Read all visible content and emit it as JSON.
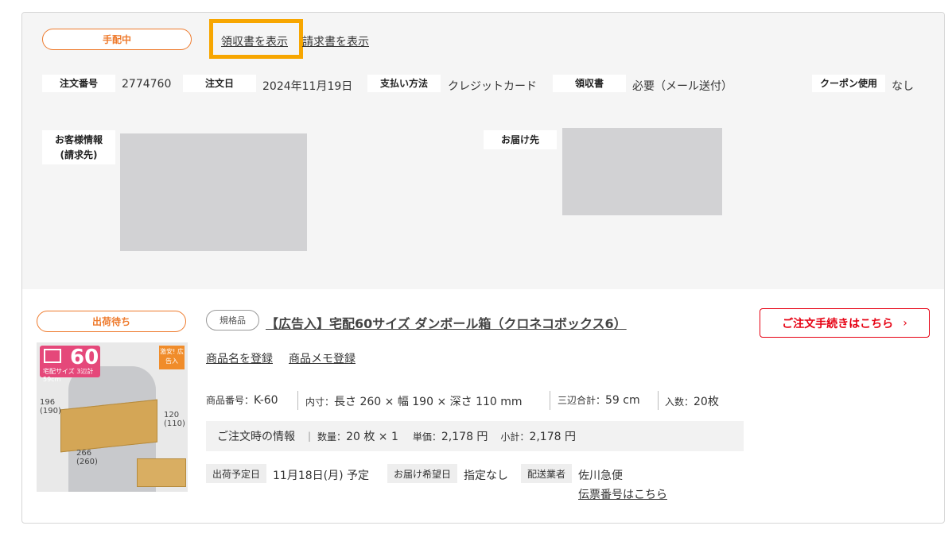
{
  "header": {
    "status": "手配中",
    "receipt_link": "領収書を表示",
    "invoice_link": "請求書を表示"
  },
  "order": {
    "number_label": "注文番号",
    "number": "2774760",
    "date_label": "注文日",
    "date": "2024年11月19日",
    "payment_label": "支払い方法",
    "payment": "クレジットカード",
    "receipt_label": "領収書",
    "receipt": "必要（メール送付）",
    "coupon_label": "クーポン使用",
    "coupon": "なし"
  },
  "customer": {
    "billing_label_line1": "お客様情報",
    "billing_label_line2": "(請求先)",
    "delivery_label": "お届け先"
  },
  "item": {
    "status": "出荷待ち",
    "tag": "規格品",
    "title": "【広告入】宅配60サイズ ダンボール箱（クロネコボックス6）",
    "cta": "ご注文手続きはこちら",
    "register_name_link": "商品名を登録",
    "register_memo_link": "商品メモ登録",
    "product_no_label": "商品番号：",
    "product_no": "K-60",
    "inner_label": "内寸：",
    "inner": "長さ 260 × 幅 190 × 深さ 110 mm",
    "sum_label": "三辺合計：",
    "sum": "59 cm",
    "count_label": "入数：",
    "count": "20枚",
    "order_info_label": "ご注文時の情報",
    "qty_label": "数量：",
    "qty": "20 枚 × 1",
    "unit_label": "単価：",
    "unit": "2,178 円",
    "subtotal_label": "小計：",
    "subtotal": "2,178 円",
    "ship_date_label": "出荷予定日",
    "ship_date": "11月18日(月) 予定",
    "wish_date_label": "お届け希望日",
    "wish_date": "指定なし",
    "carrier_label": "配送業者",
    "carrier": "佐川急便",
    "tracking_link": "伝票番号はこちら"
  },
  "image": {
    "size_num": "60",
    "size_sub": "宅配サイズ 3辺計59cm",
    "badge": "激安! 広告入",
    "dim_left": "196 (190)",
    "dim_right": "120 (110)",
    "dim_bottom": "266 (260)"
  },
  "colors": {
    "orange": "#ee7a2c",
    "highlight": "#f7a600",
    "red": "#e60012"
  }
}
